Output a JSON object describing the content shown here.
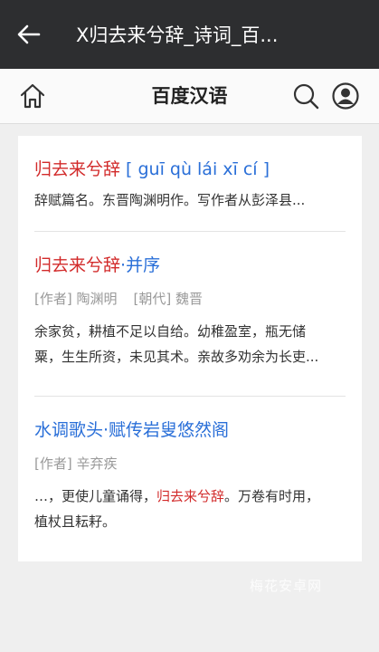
{
  "topbar": {
    "title": "X归去来兮辞_诗词_百..."
  },
  "navbar": {
    "title": "百度汉语"
  },
  "entries": [
    {
      "title": "归去来兮辞",
      "pinyin": "[ guī qù lái xī cí ]",
      "desc": "辞赋篇名。东晋陶渊明作。写作者从彭泽县..."
    },
    {
      "title_red": "归去来兮辞",
      "title_sep": "·",
      "title_blue": "并序",
      "author": "[作者] 陶渊明",
      "dynasty": "[朝代] 魏晋",
      "desc_line1": "余家贫，耕植不足以自给。幼稚盈室，瓶无储",
      "desc_line2": "粟，生生所资，未见其术。亲故多劝余为长吏..."
    },
    {
      "title": "水调歌头·赋传岩叟悠然阁",
      "author": "[作者] 辛弃疾",
      "desc_line1_a": "…，更使儿童诵得，",
      "desc_line1_hl": "归去来兮辞",
      "desc_line1_b": "。万卷有时用，",
      "desc_line2": "植杖且耘耔。"
    }
  ],
  "watermark": "梅花安卓网",
  "colors": {
    "topbar": "#2d2e30",
    "highlight_red": "#d22a2a",
    "link_blue": "#2a6fd8"
  }
}
